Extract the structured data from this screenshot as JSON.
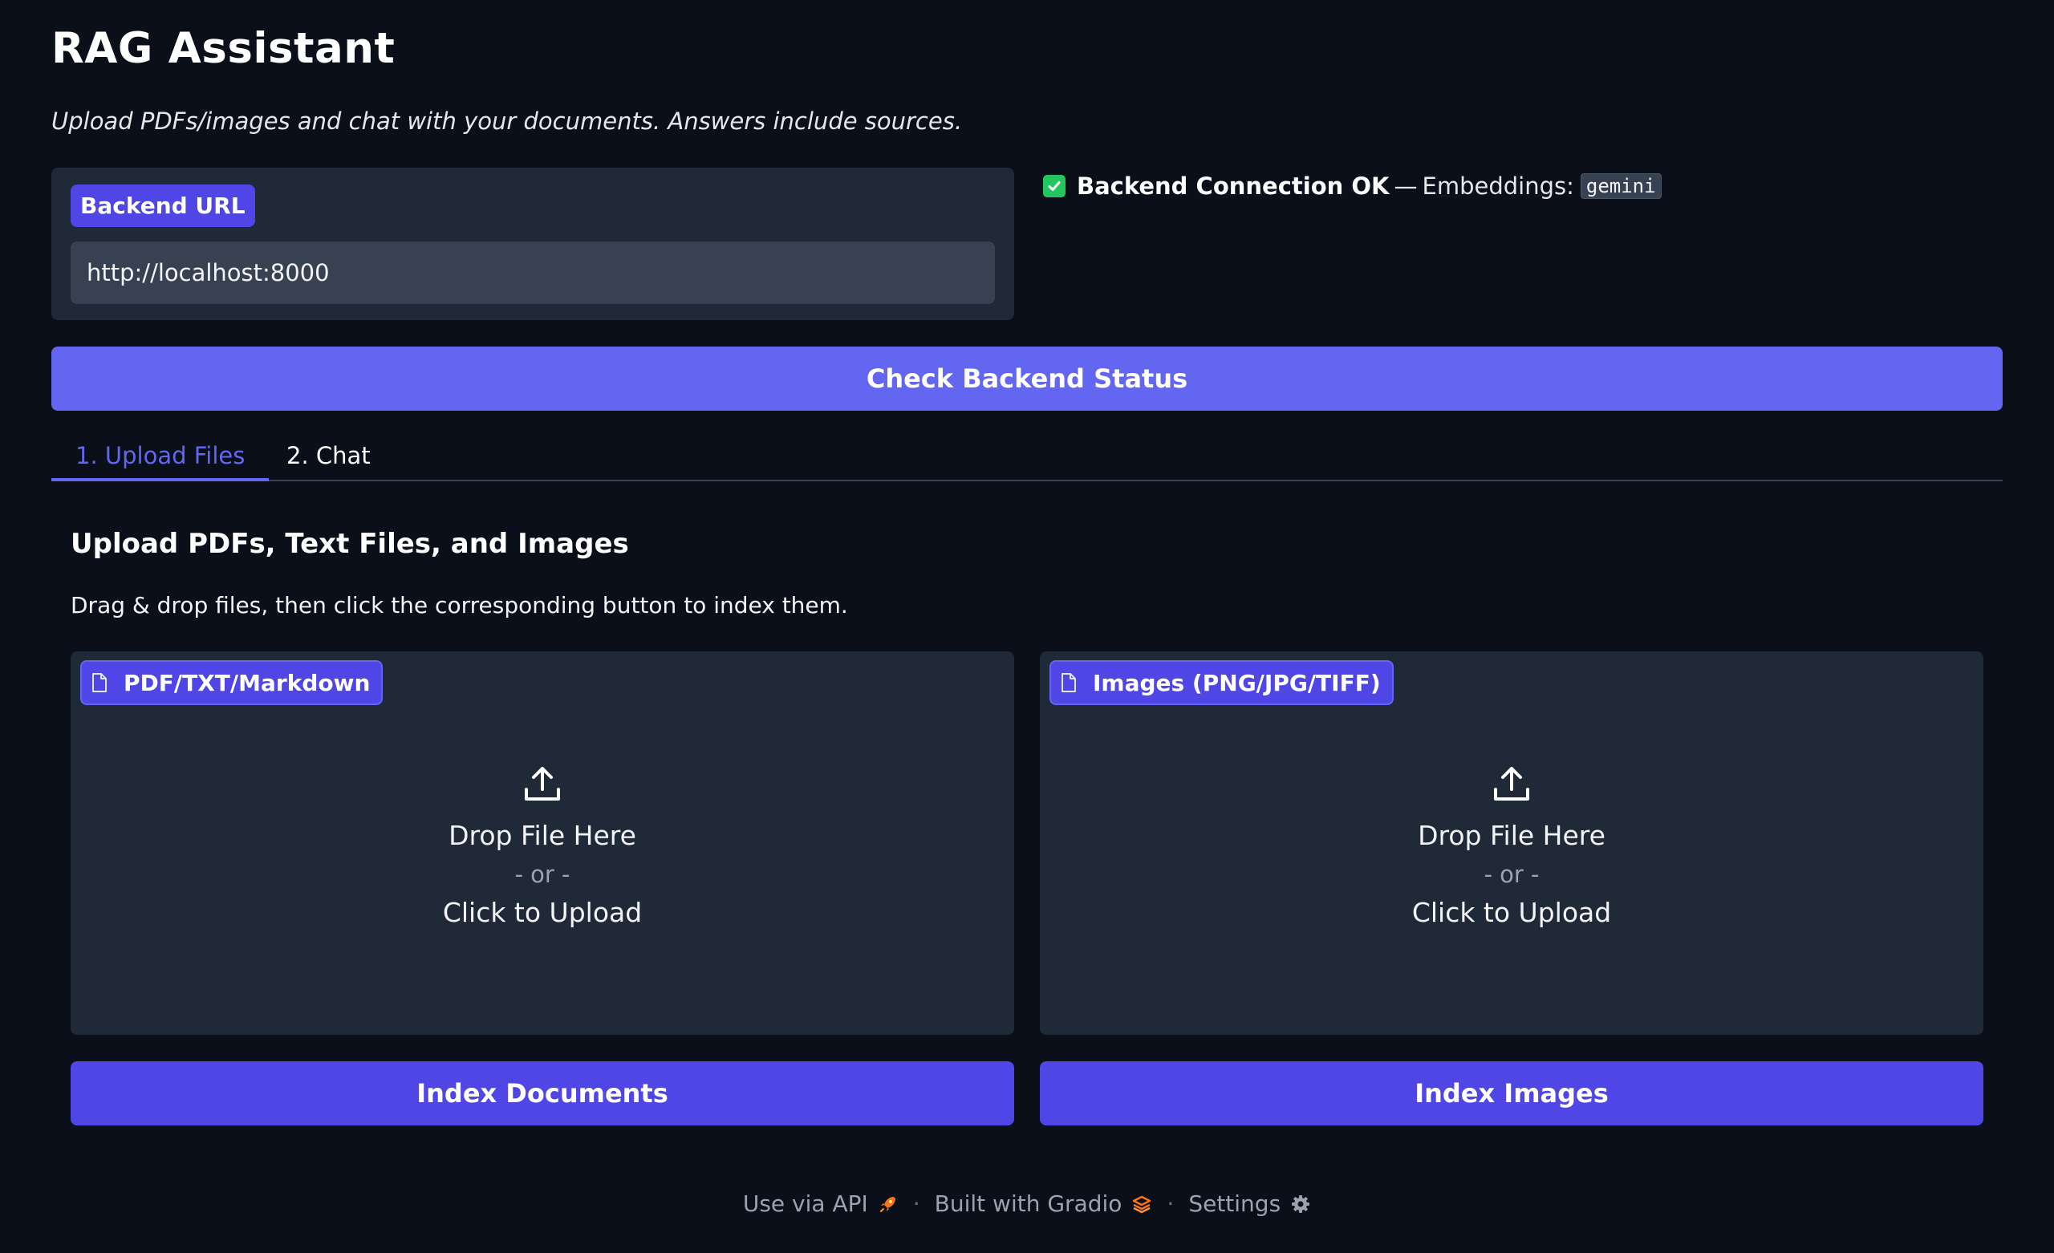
{
  "header": {
    "title": "RAG Assistant",
    "subtitle": "Upload PDFs/images and chat with your documents. Answers include sources."
  },
  "backend": {
    "label": "Backend URL",
    "url_value": "http://localhost:8000",
    "status_strong": "Backend Connection OK",
    "status_sep": "—",
    "status_rest": "Embeddings:",
    "embeddings_code": "gemini",
    "check_button": "Check Backend Status"
  },
  "tabs": [
    {
      "label": "1. Upload Files",
      "active": true
    },
    {
      "label": "2. Chat",
      "active": false
    }
  ],
  "upload_section": {
    "title": "Upload PDFs, Text Files, and Images",
    "description": "Drag & drop files, then click the corresponding button to index them.",
    "documents": {
      "label": "PDF/TXT/Markdown",
      "drop_text": "Drop File Here",
      "or_text": "- or -",
      "click_text": "Click to Upload",
      "button": "Index Documents"
    },
    "images": {
      "label": "Images (PNG/JPG/TIFF)",
      "drop_text": "Drop File Here",
      "or_text": "- or -",
      "click_text": "Click to Upload",
      "button": "Index Images"
    }
  },
  "footer": {
    "api_label": "Use via API",
    "built_label": "Built with Gradio",
    "settings_label": "Settings",
    "separator": "·"
  },
  "colors": {
    "background": "#0b0f19",
    "panel": "#1f2937",
    "accent": "#6366f1",
    "accent_dark": "#4f46e5",
    "success": "#22c55e"
  },
  "icons": [
    "check-icon",
    "file-icon",
    "upload-icon",
    "rocket-icon",
    "gradio-logo-icon",
    "gear-icon"
  ]
}
